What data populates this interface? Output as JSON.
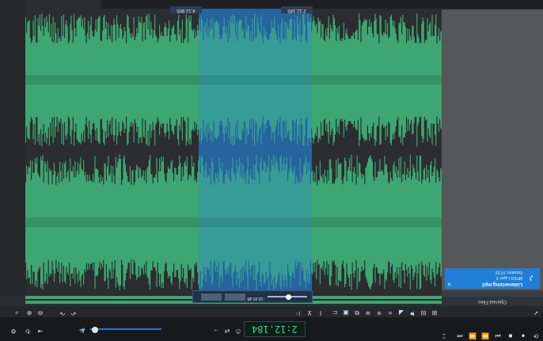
{
  "timecode": "2:12.184",
  "selection": {
    "start": "4:12.905",
    "end": "2:12.185",
    "popup_value": "-15.03 dB"
  },
  "side_panel": {
    "header": "Opened Files",
    "file": {
      "name": "Listenerizing.mp3",
      "meta1": "MPEG Layer 3",
      "meta2": "Duration: 07:52"
    }
  },
  "colors": {
    "waveform": "#3da672",
    "selection": "#1f6fbf",
    "accent": "#1f7fd6",
    "timecode": "#39d28b"
  }
}
